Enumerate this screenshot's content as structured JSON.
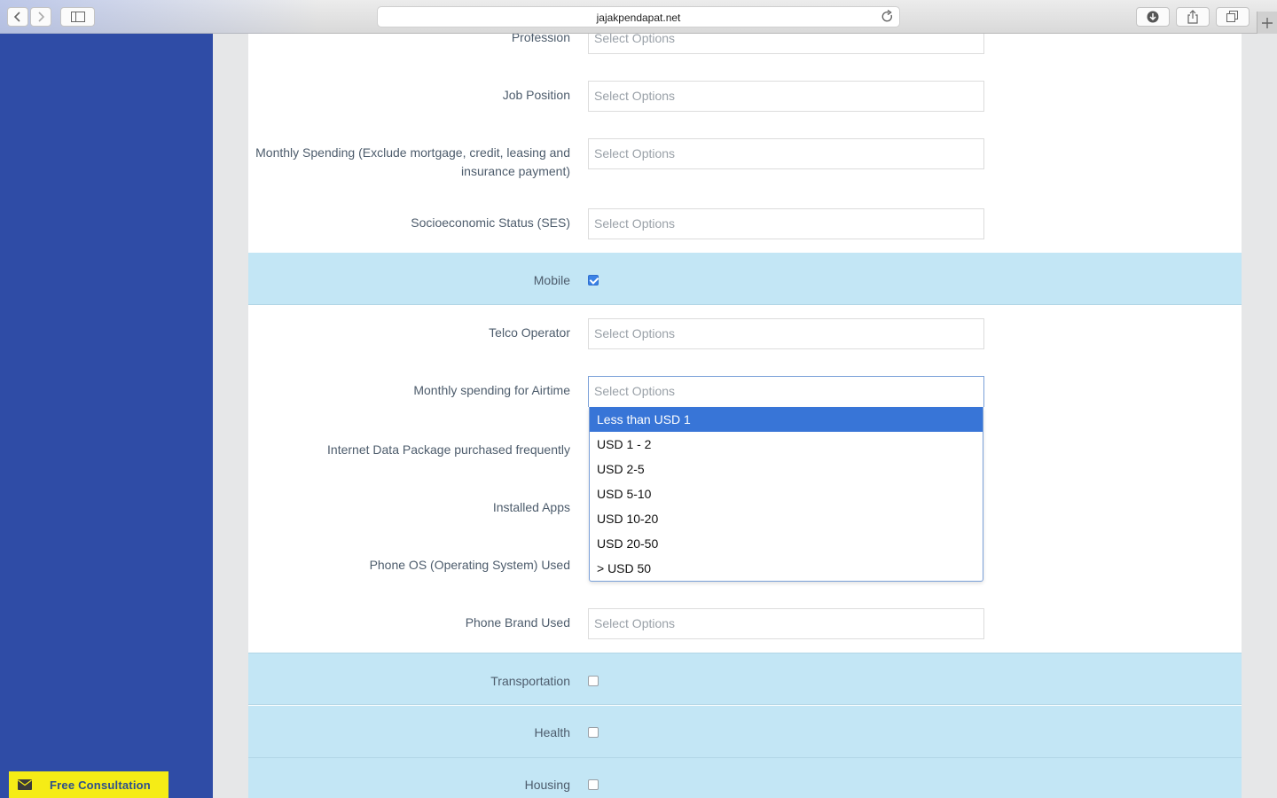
{
  "browser": {
    "url": "jajakpendapat.net"
  },
  "form": {
    "profession": {
      "label": "Profession",
      "placeholder": "Select Options"
    },
    "job_position": {
      "label": "Job Position",
      "placeholder": "Select Options"
    },
    "monthly_spending": {
      "label_line1": "Monthly Spending (Exclude mortgage, credit, leasing and",
      "label_line2": "insurance payment)",
      "placeholder": "Select Options"
    },
    "ses": {
      "label": "Socioeconomic Status (SES)",
      "placeholder": "Select Options"
    },
    "mobile": {
      "label": "Mobile",
      "checked": true
    },
    "telco": {
      "label": "Telco Operator",
      "placeholder": "Select Options"
    },
    "airtime": {
      "label": "Monthly spending for Airtime",
      "placeholder": "Select Options",
      "options": [
        "Less than USD 1",
        "USD 1 - 2",
        "USD 2-5",
        "USD 5-10",
        "USD 10-20",
        "USD 20-50",
        "> USD 50"
      ],
      "highlighted": "Less than USD 1"
    },
    "internet_package": {
      "label": "Internet Data Package purchased frequently"
    },
    "installed_apps": {
      "label": "Installed Apps"
    },
    "phone_os": {
      "label": "Phone OS (Operating System) Used"
    },
    "phone_brand": {
      "label": "Phone Brand Used",
      "placeholder": "Select Options"
    },
    "transportation": {
      "label": "Transportation",
      "checked": false
    },
    "health": {
      "label": "Health",
      "checked": false
    },
    "housing": {
      "label": "Housing",
      "checked": false
    }
  },
  "consultation": {
    "label": "Free Consultation",
    "icon": "envelope-icon"
  },
  "colors": {
    "sidebar": "#2f4ca6",
    "band": "#c3e6f5",
    "highlight": "#3875d7",
    "consult_bg": "#f5ec16"
  }
}
